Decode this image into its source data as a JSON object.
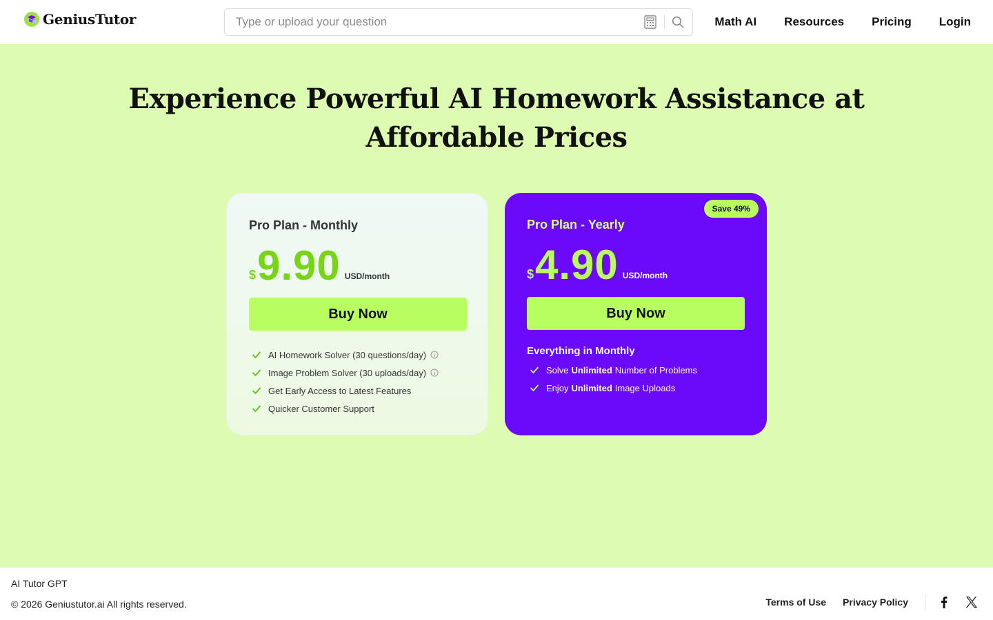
{
  "header": {
    "brand": "GeniusTutor",
    "search_placeholder": "Type or upload your question",
    "nav": [
      "Math AI",
      "Resources",
      "Pricing",
      "Login"
    ]
  },
  "hero": {
    "title_line1": "Experience Powerful AI Homework Assistance at",
    "title_line2": "Affordable Prices"
  },
  "plans": {
    "monthly": {
      "name": "Pro Plan - Monthly",
      "currency": "$",
      "amount": "9.90",
      "unit": "USD/month",
      "button": "Buy Now",
      "features": [
        "AI Homework Solver (30 questions/day)",
        "Image Problem Solver (30 uploads/day)",
        "Get Early Access to Latest Features",
        "Quicker Customer Support"
      ]
    },
    "yearly": {
      "name": "Pro Plan - Yearly",
      "badge": "Save 49%",
      "currency": "$",
      "amount": "4.90",
      "unit": "USD/month",
      "button": "Buy Now",
      "includes": "Everything in Monthly",
      "features": [
        {
          "pre": "Solve",
          "bold": "Unlimited",
          "post": "Number of Problems"
        },
        {
          "pre": "Enjoy",
          "bold": "Unlimited",
          "post": "Image Uploads"
        }
      ]
    }
  },
  "footer": {
    "brand": "AI Tutor GPT",
    "copyright": "© 2026 Geniustutor.ai All rights reserved.",
    "links": [
      "Terms of Use",
      "Privacy Policy"
    ]
  },
  "colors": {
    "page_bg": "#ddfcb1",
    "accent_green": "#b9fe5f",
    "price_green": "#77d516",
    "purple": "#6b0af8"
  },
  "icons": [
    "logo-icon",
    "calculator-icon",
    "search-icon",
    "check-icon",
    "info-icon",
    "facebook-icon",
    "x-icon"
  ]
}
